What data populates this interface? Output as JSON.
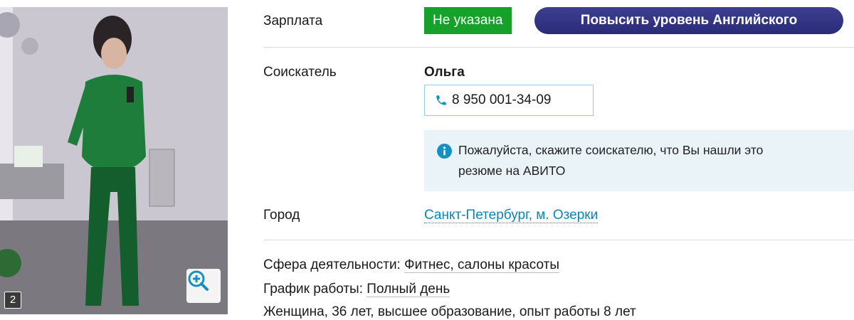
{
  "photo": {
    "counter": "2"
  },
  "fields": {
    "salary_label": "Зарплата",
    "salary_value": "Не указана",
    "promo_label": "Повысить уровень Английского",
    "applicant_label": "Соискатель",
    "applicant_name": "Ольга",
    "phone": "8 950 001-34-09",
    "notice_line1": "Пожалуйста, скажите соискателю, что Вы нашли это",
    "notice_line2": "резюме на АВИТО",
    "city_label": "Город",
    "city_value": "Санкт-Петербург, м. Озерки"
  },
  "details": {
    "sphere_label": "Сфера деятельности: ",
    "sphere_value": "Фитнес, салоны красоты",
    "schedule_label": "График работы: ",
    "schedule_value": "Полный день",
    "summary": "Женщина, 36 лет, высшее образование, опыт работы 8 лет"
  },
  "colors": {
    "salary_green": "#15a12a",
    "promo_navy": "#2a2b78",
    "link_blue": "#0a86b5",
    "notice_bg": "#e9f3f8"
  },
  "icons": [
    "phone-icon",
    "info-icon",
    "zoom-in-icon",
    "photo-counter"
  ]
}
